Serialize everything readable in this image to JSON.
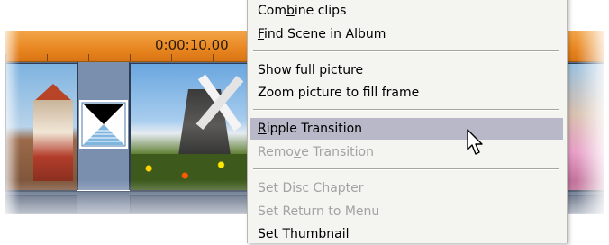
{
  "timeline": {
    "timecode": "0:00:10.00"
  },
  "menu": {
    "items": [
      {
        "pre": "Com",
        "mnem": "b",
        "post": "ine clips",
        "enabled": true
      },
      {
        "pre": "",
        "mnem": "F",
        "post": "ind Scene in Album",
        "enabled": true
      },
      {
        "pre": "Show full picture",
        "mnem": "",
        "post": "",
        "enabled": true
      },
      {
        "pre": "Zoom picture to fill frame",
        "mnem": "",
        "post": "",
        "enabled": true
      },
      {
        "pre": "",
        "mnem": "R",
        "post": "ipple Transition",
        "enabled": true,
        "highlighted": true
      },
      {
        "pre": "Remo",
        "mnem": "v",
        "post": "e Transition",
        "enabled": false
      },
      {
        "pre": "Set Disc Chapter",
        "mnem": "",
        "post": "",
        "enabled": false
      },
      {
        "pre": "Set Return to Menu",
        "mnem": "",
        "post": "",
        "enabled": false
      },
      {
        "pre": "Set Thumbnail",
        "mnem": "",
        "post": "",
        "enabled": true
      }
    ]
  },
  "icons": {
    "transition": "hourglass-transition-icon",
    "pointer": "arrow-cursor-icon"
  },
  "colors": {
    "ruler": "#e88620",
    "track": "#5a6e8c",
    "menu_bg": "#f4f4f0",
    "highlight": "#b8b8c8",
    "disabled_text": "#a3a3a3"
  }
}
